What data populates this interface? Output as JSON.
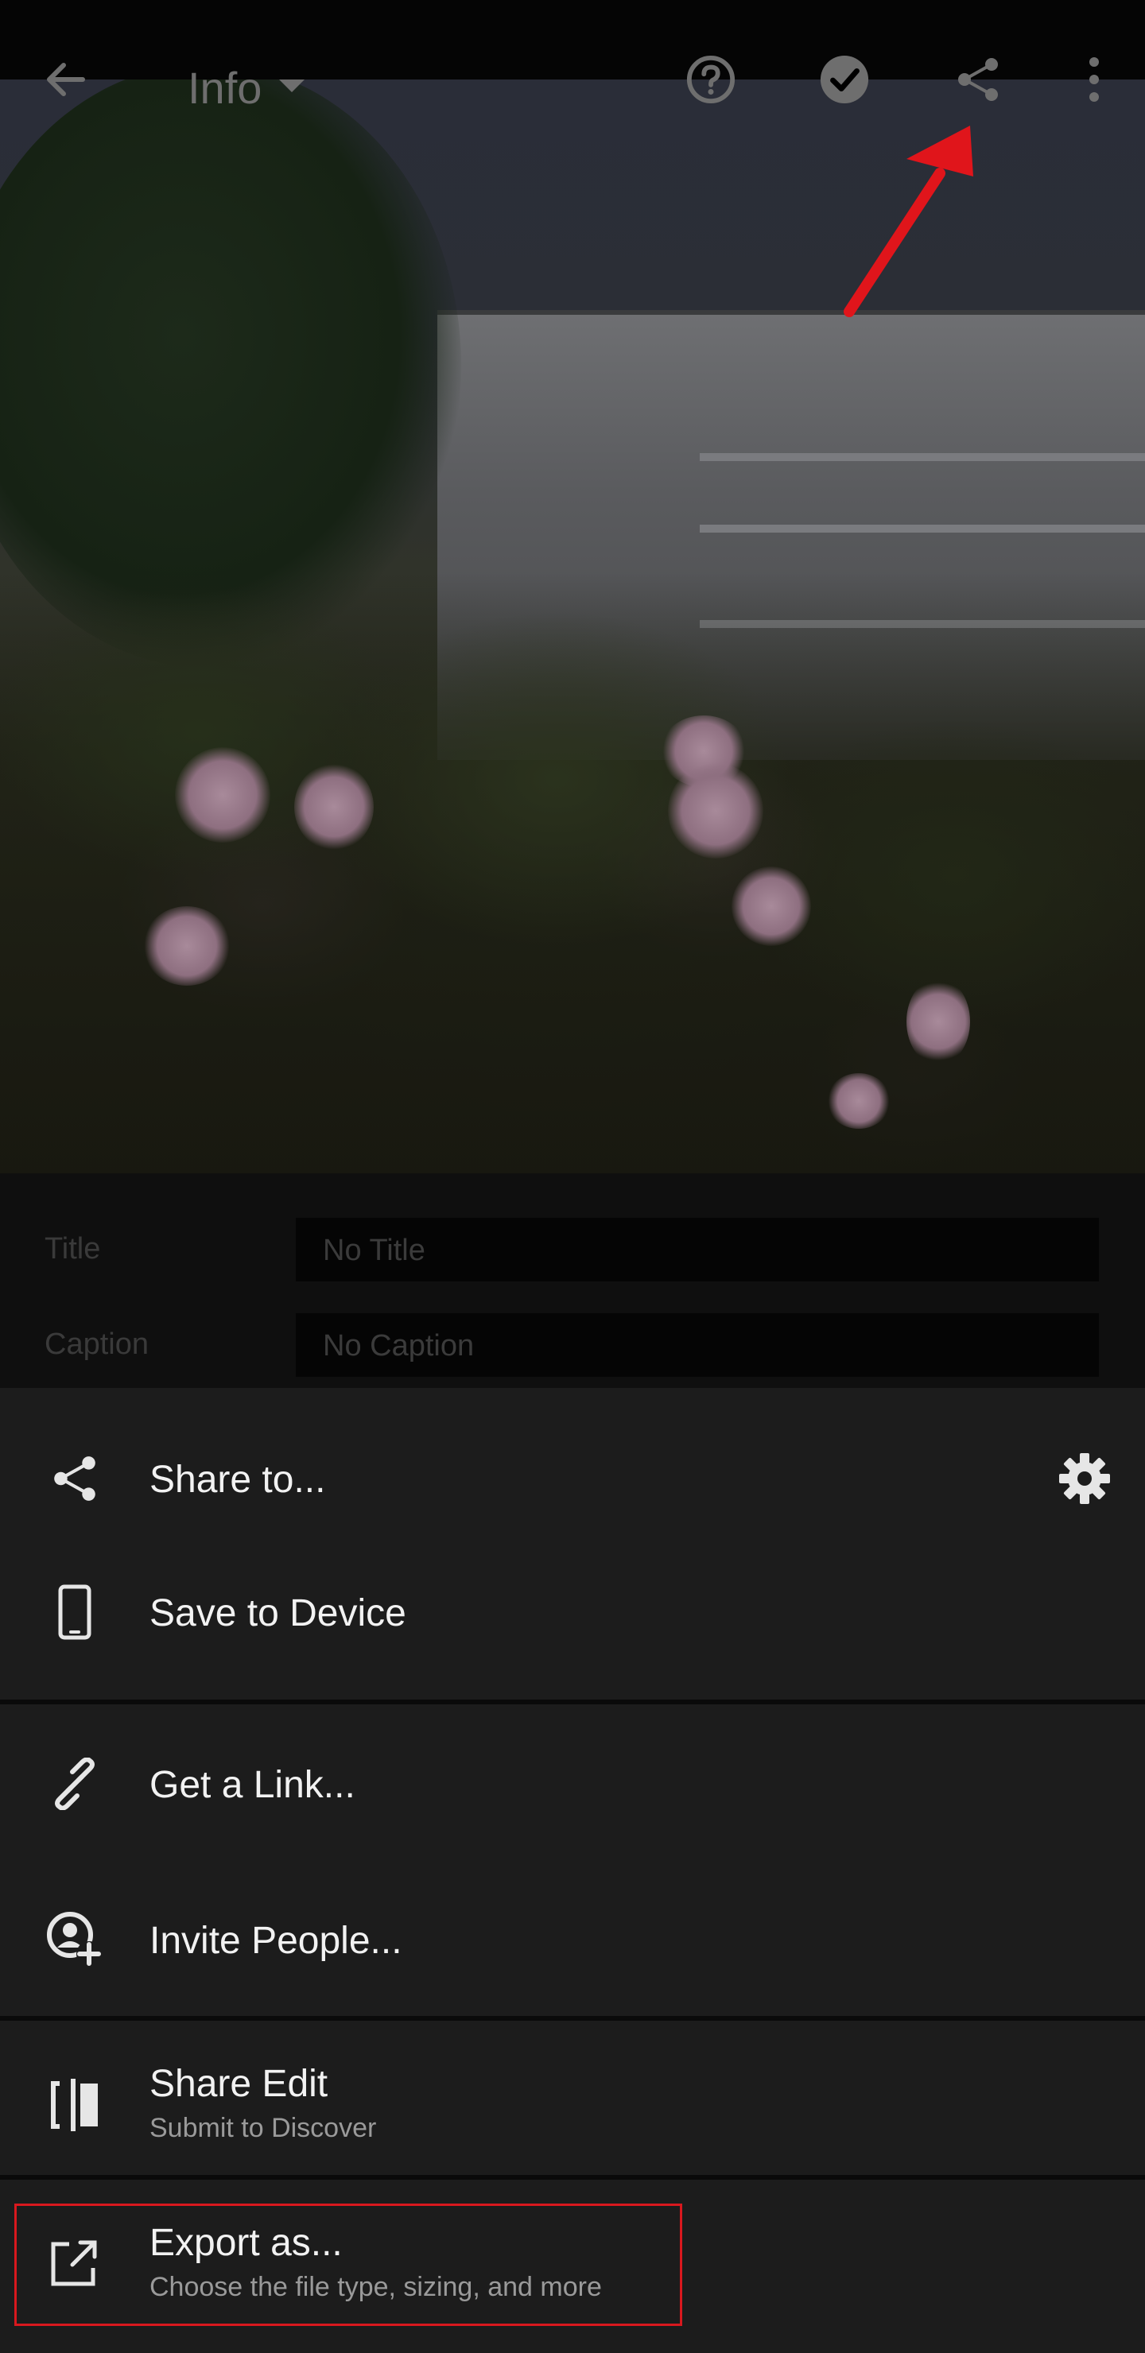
{
  "topbar": {
    "title": "Info",
    "icons": [
      "back-arrow-icon",
      "dropdown-caret-icon",
      "help-icon",
      "checkmark-icon",
      "share-icon",
      "more-vertical-icon"
    ]
  },
  "info": {
    "title_label": "Title",
    "title_value": "No Title",
    "caption_label": "Caption",
    "caption_value": "No Caption"
  },
  "sheet": {
    "share_to": "Share to...",
    "save_to_device": "Save to Device",
    "get_link": "Get a Link...",
    "invite_people": "Invite People...",
    "share_edit": "Share Edit",
    "share_edit_sub": "Submit to Discover",
    "export_as": "Export as...",
    "export_as_sub": "Choose the file type, sizing, and more"
  },
  "colors": {
    "sheet_bg": "#1c1c1c",
    "annotation_red": "#e0151b"
  }
}
